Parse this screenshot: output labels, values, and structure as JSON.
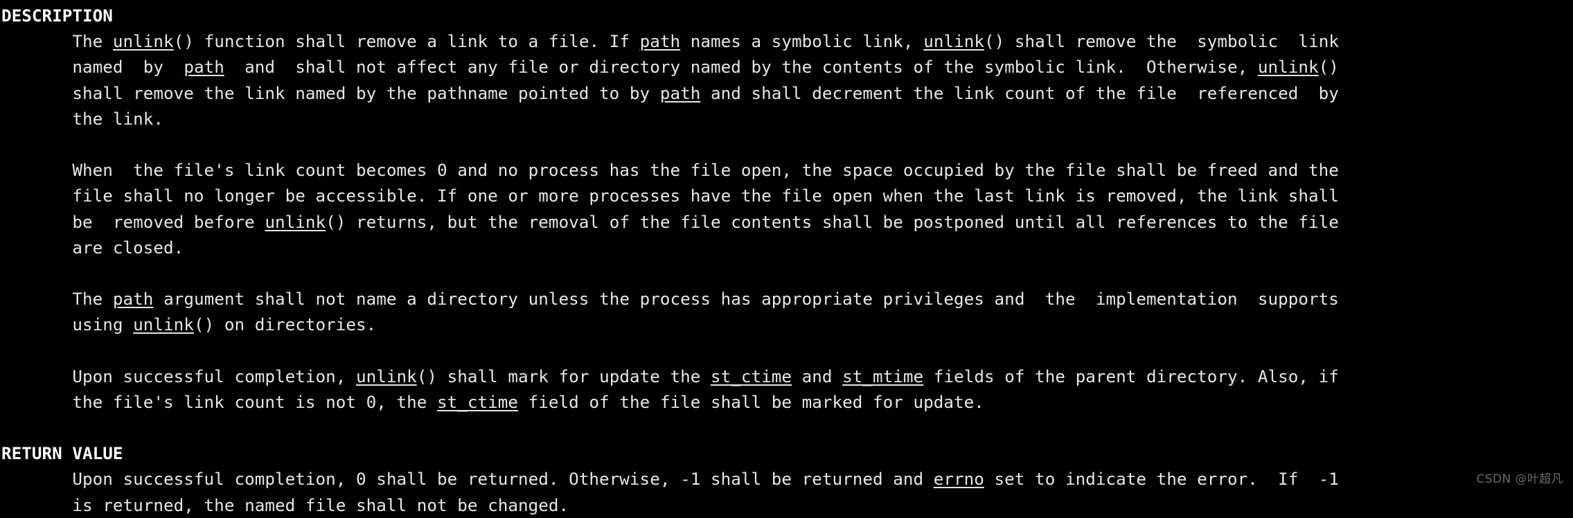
{
  "terminal": {
    "background": "#000000",
    "foreground": "#e6e6e6",
    "watermark": "CSDN @叶超凡"
  },
  "man_page": {
    "sections": [
      {
        "heading": "DESCRIPTION",
        "paragraphs": [
          {
            "lines": [
              [
                {
                  "t": "       The "
                },
                {
                  "t": "unlink",
                  "u": true
                },
                {
                  "t": "() function shall remove a link to a file. If "
                },
                {
                  "t": "path",
                  "u": true
                },
                {
                  "t": " names a symbolic link, "
                },
                {
                  "t": "unlink",
                  "u": true
                },
                {
                  "t": "() shall remove the  symbolic  link"
                }
              ],
              [
                {
                  "t": "       named  by  "
                },
                {
                  "t": "path",
                  "u": true
                },
                {
                  "t": "  and  shall not affect any file or directory named by the contents of the symbolic link.  Otherwise, "
                },
                {
                  "t": "unlink",
                  "u": true
                },
                {
                  "t": "()"
                }
              ],
              [
                {
                  "t": "       shall remove the link named by the pathname pointed to by "
                },
                {
                  "t": "path",
                  "u": true
                },
                {
                  "t": " and shall decrement the link count of the file  referenced  by"
                }
              ],
              [
                {
                  "t": "       the link."
                }
              ]
            ]
          },
          {
            "lines": [
              [
                {
                  "t": "       When  the file's link count becomes 0 and no process has the file open, the space occupied by the file shall be freed and the"
                }
              ],
              [
                {
                  "t": "       file shall no longer be accessible. If one or more processes have the file open when the last link is removed, the link shall"
                }
              ],
              [
                {
                  "t": "       be  removed before "
                },
                {
                  "t": "unlink",
                  "u": true
                },
                {
                  "t": "() returns, but the removal of the file contents shall be postponed until all references to the file"
                }
              ],
              [
                {
                  "t": "       are closed."
                }
              ]
            ]
          },
          {
            "lines": [
              [
                {
                  "t": "       The "
                },
                {
                  "t": "path",
                  "u": true
                },
                {
                  "t": " argument shall not name a directory unless the process has appropriate privileges and  the  implementation  supports"
                }
              ],
              [
                {
                  "t": "       using "
                },
                {
                  "t": "unlink",
                  "u": true
                },
                {
                  "t": "() on directories."
                }
              ]
            ]
          },
          {
            "lines": [
              [
                {
                  "t": "       Upon successful completion, "
                },
                {
                  "t": "unlink",
                  "u": true
                },
                {
                  "t": "() shall mark for update the "
                },
                {
                  "t": "st_ctime",
                  "u": true
                },
                {
                  "t": " and "
                },
                {
                  "t": "st_mtime",
                  "u": true
                },
                {
                  "t": " fields of the parent directory. Also, if"
                }
              ],
              [
                {
                  "t": "       the file's link count is not 0, the "
                },
                {
                  "t": "st_ctime",
                  "u": true
                },
                {
                  "t": " field of the file shall be marked for update."
                }
              ]
            ]
          }
        ]
      },
      {
        "heading": "RETURN VALUE",
        "paragraphs": [
          {
            "lines": [
              [
                {
                  "t": "       Upon successful completion, 0 shall be returned. Otherwise, -1 shall be returned and "
                },
                {
                  "t": "errno",
                  "u": true
                },
                {
                  "t": " set to indicate the error.  If  -1"
                }
              ],
              [
                {
                  "t": "       is returned, the named file shall not be changed."
                }
              ]
            ]
          }
        ]
      }
    ]
  }
}
